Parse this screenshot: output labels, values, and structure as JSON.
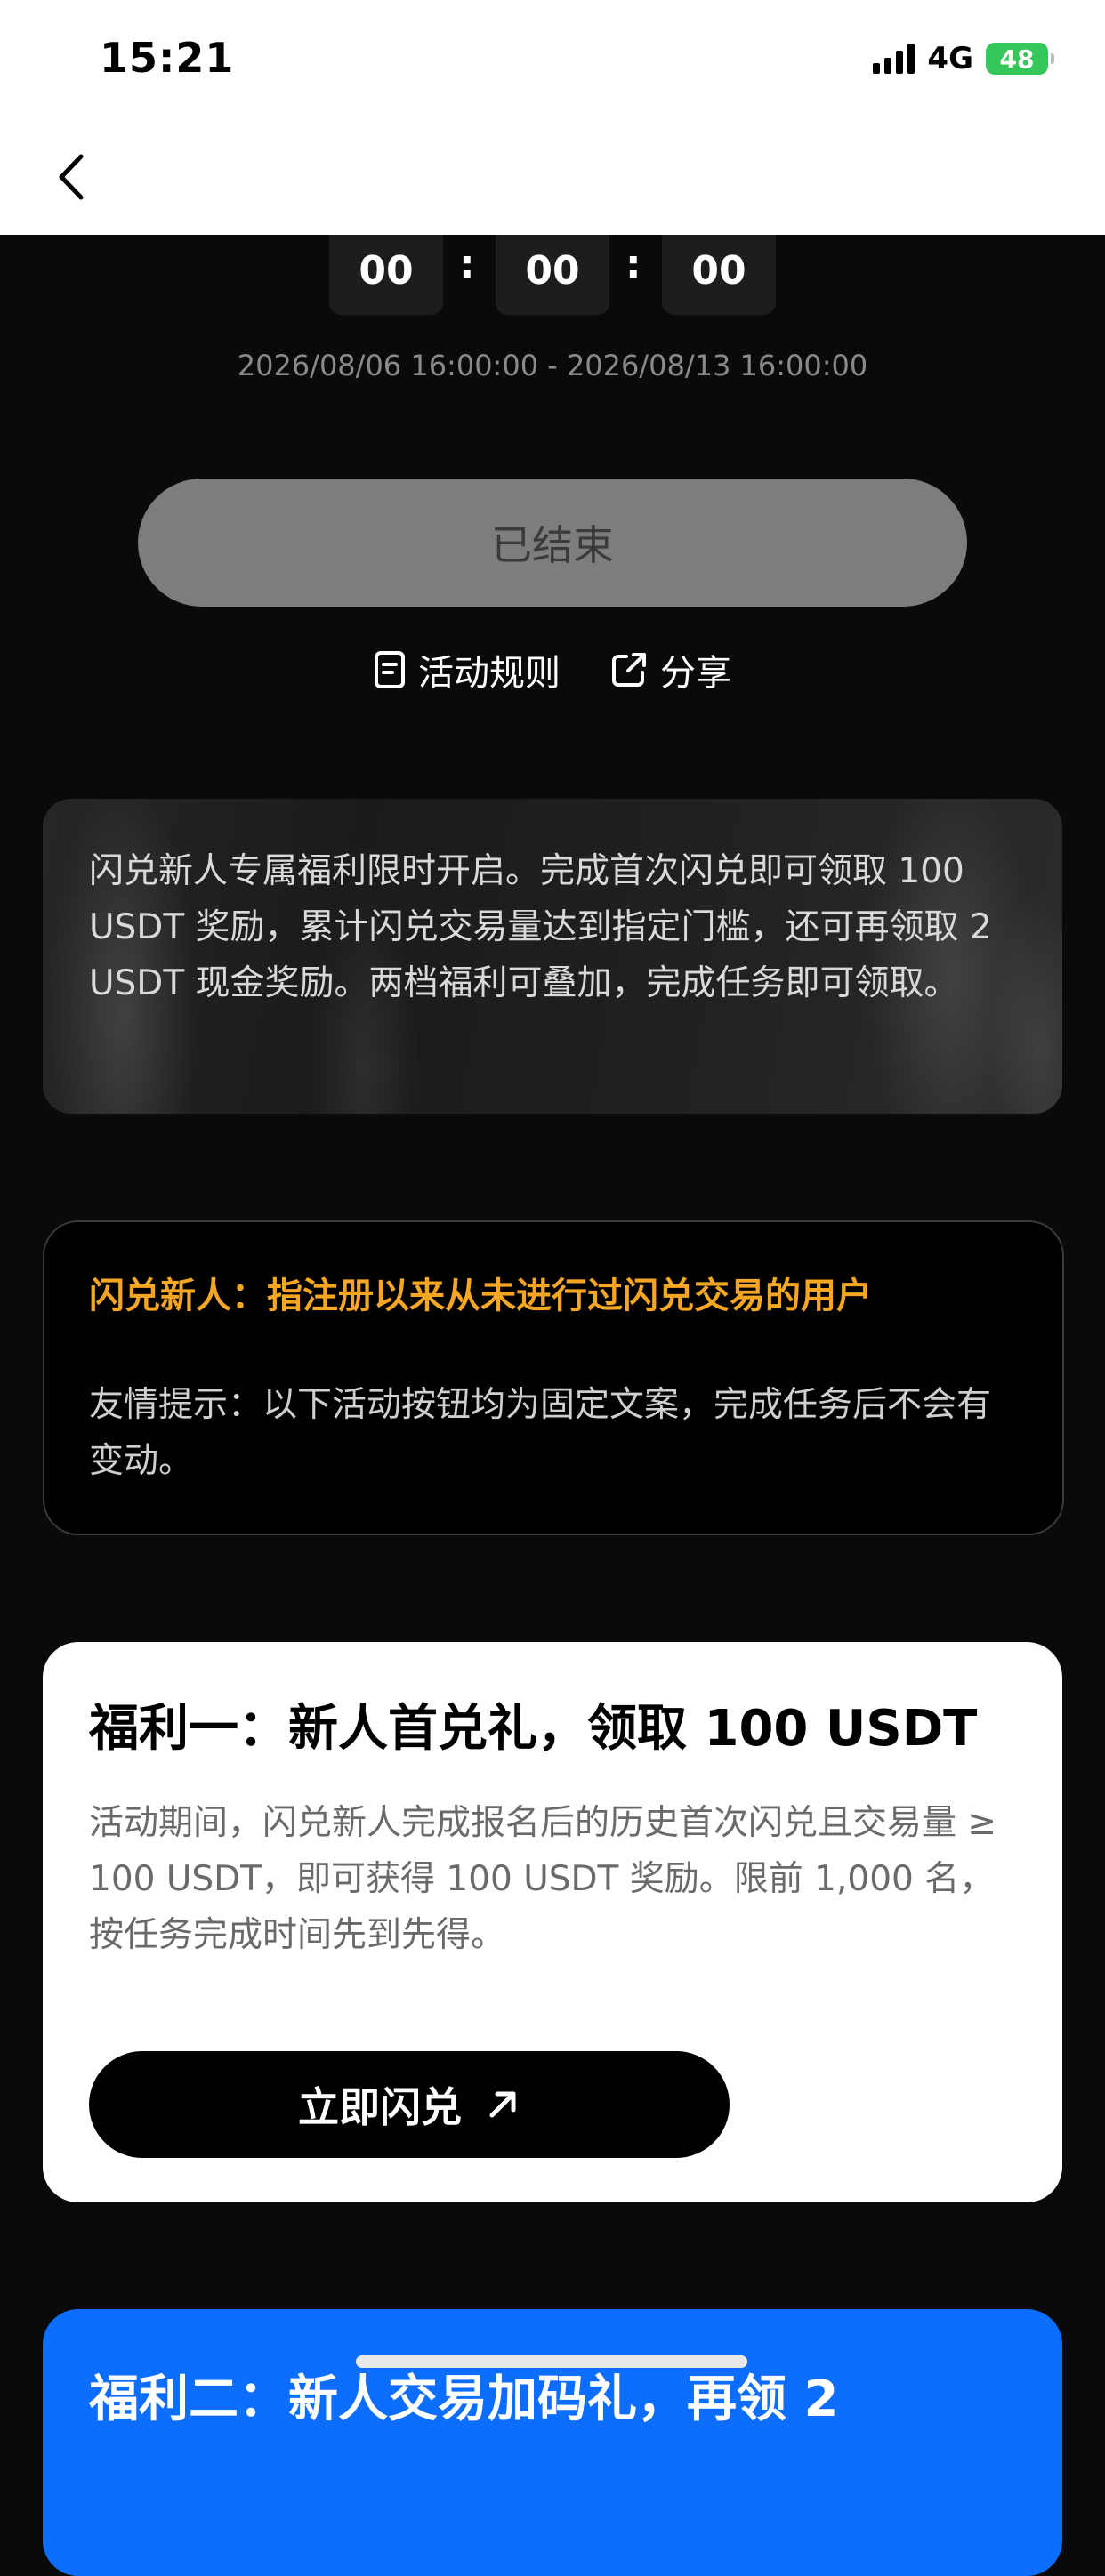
{
  "status_bar": {
    "time": "15:21",
    "network": "4G",
    "battery": "48"
  },
  "countdown": {
    "hours": "00",
    "minutes": "00",
    "seconds": "00",
    "separator": ":"
  },
  "period": "2026/08/06 16:00:00 - 2026/08/13 16:00:00",
  "status_button": "已结束",
  "links": {
    "rules": "活动规则",
    "share": "分享"
  },
  "intro": "闪兑新人专属福利限时开启。完成首次闪兑即可领取 100 USDT 奖励，累计闪兑交易量达到指定门槛，还可再领取 2 USDT 现金奖励。两档福利可叠加，完成任务即可领取。",
  "notice": {
    "title": "闪兑新人：指注册以来从未进行过闪兑交易的用户",
    "tip": "友情提示：以下活动按钮均为固定文案，完成任务后不会有变动。"
  },
  "benefit1": {
    "title": "福利一：新人首兑礼，领取 100 USDT",
    "desc": "活动期间，闪兑新人完成报名后的历史首次闪兑且交易量 ≥ 100 USDT，即可获得 100 USDT 奖励。限前 1,000 名，按任务完成时间先到先得。",
    "button": "立即闪兑"
  },
  "benefit2": {
    "title": "福利二：新人交易加码礼，再领 2"
  },
  "colors": {
    "accent_orange": "#f5a623",
    "accent_blue": "#0d6efd",
    "battery_green": "#35c759"
  }
}
